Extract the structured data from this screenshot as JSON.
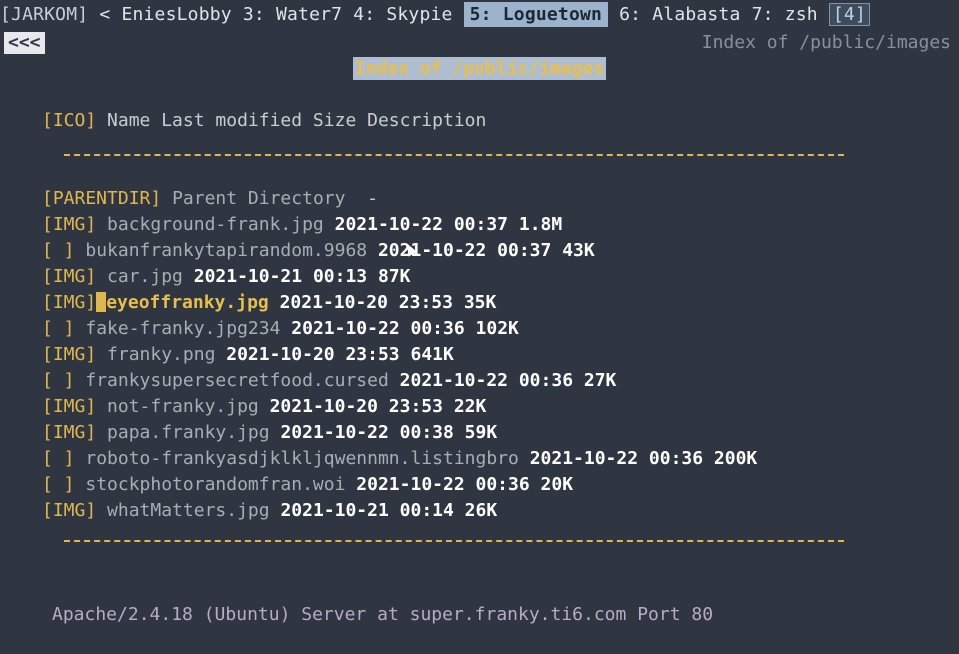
{
  "tabbar": {
    "session": "[JARKOM]",
    "prev_arrow": "<",
    "tabs": [
      {
        "label": "EniesLobby"
      },
      {
        "label": "3: Water7"
      },
      {
        "label": "4: Skypie"
      },
      {
        "label": "5: Loguetown",
        "active": true
      },
      {
        "label": "6: Alabasta"
      },
      {
        "label": "7: zsh"
      }
    ],
    "count": "[4]"
  },
  "nav": {
    "back_label": "<<<",
    "page_title": "Index of /public/images"
  },
  "page": {
    "heading": "Index of /public/images",
    "header_row": {
      "ico": "[ICO]",
      "columns": "Name Last modified Size Description"
    },
    "parent": {
      "tag": "[PARENTDIR]",
      "name": "Parent Directory",
      "size": "-"
    },
    "files": [
      {
        "tag": "[IMG]",
        "name": "background-frank.jpg",
        "modified": "2021-10-22 00:37",
        "size": "1.8M"
      },
      {
        "tag": "[ ]",
        "name": "bukanfrankytapirandom.9968",
        "modified": "2021-10-22 00:37",
        "size": "43K"
      },
      {
        "tag": "[IMG]",
        "name": "car.jpg",
        "modified": "2021-10-21 00:13",
        "size": "87K"
      },
      {
        "tag": "[IMG]",
        "name": "eyeoffranky.jpg",
        "modified": "2021-10-20 23:53",
        "size": "35K",
        "selected": true
      },
      {
        "tag": "[ ]",
        "name": "fake-franky.jpg234",
        "modified": "2021-10-22 00:36",
        "size": "102K"
      },
      {
        "tag": "[IMG]",
        "name": "franky.png",
        "modified": "2021-10-20 23:53",
        "size": "641K"
      },
      {
        "tag": "[ ]",
        "name": "frankysupersecretfood.cursed",
        "modified": "2021-10-22 00:36",
        "size": "27K"
      },
      {
        "tag": "[IMG]",
        "name": "not-franky.jpg",
        "modified": "2021-10-20 23:53",
        "size": "22K"
      },
      {
        "tag": "[IMG]",
        "name": "papa.franky.jpg",
        "modified": "2021-10-22 00:38",
        "size": "59K"
      },
      {
        "tag": "[ ]",
        "name": "roboto-frankyasdjklkljqwennmn.listingbro",
        "modified": "2021-10-22 00:36",
        "size": "200K"
      },
      {
        "tag": "[ ]",
        "name": "stockphotorandomfran.woi",
        "modified": "2021-10-22 00:36",
        "size": "20K"
      },
      {
        "tag": "[IMG]",
        "name": "whatMatters.jpg",
        "modified": "2021-10-21 00:14",
        "size": "26K"
      }
    ],
    "footer": "Apache/2.4.18 (Ubuntu) Server at super.franky.ti6.com Port 80"
  },
  "colors": {
    "background": "#2f3642",
    "accent": "#e0b74f",
    "active_tab": "#9bb3cc"
  },
  "icons": {
    "mouse": "mouse-pointer-icon"
  }
}
